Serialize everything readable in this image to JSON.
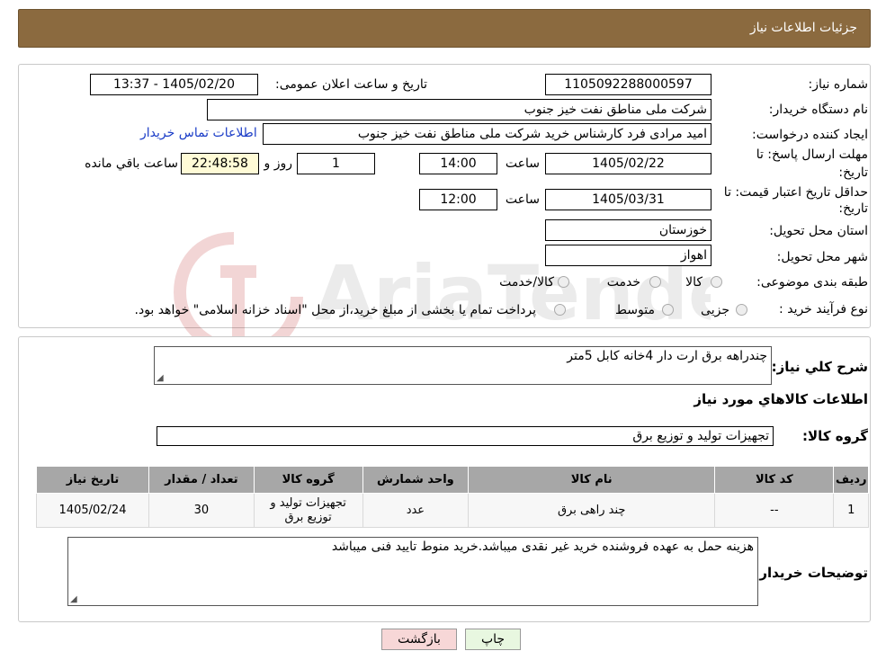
{
  "header": {
    "title": "جزئیات اطلاعات نیاز"
  },
  "labels": {
    "need_number": "شماره نیاز:",
    "announce_date": "تاریخ و ساعت اعلان عمومی:",
    "buyer_org": "نام دستگاه خریدار:",
    "requester": "ایجاد کننده درخواست:",
    "reply_deadline_1": "مهلت ارسال پاسخ: تا",
    "reply_deadline_2": "تاریخ:",
    "time": "ساعت",
    "day_and": "روز و",
    "remaining": "ساعت باقي مانده",
    "price_valid_1": "حداقل تاریخ اعتبار قیمت: تا",
    "price_valid_2": "تاریخ:",
    "province": "استان محل تحویل:",
    "city": "شهر محل تحویل:",
    "category": "طبقه بندی موضوعی:",
    "process": "نوع فرآیند خرید :",
    "summary": "شرح كلي نياز:",
    "goods_info": "اطلاعات كالاهاي مورد نياز",
    "goods_group": "گروه كالا:",
    "buyer_notes": "توضیحات خریدار:"
  },
  "values": {
    "need_number": "1105092288000597",
    "announce_date": "1405/02/20 - 13:37",
    "buyer_org": "شرکت ملی مناطق نفت خیز جنوب",
    "requester": "امید مرادی فرد کارشناس خرید شرکت ملی مناطق نفت خیز جنوب",
    "contact_link": "اطلاعات تماس خریدار",
    "reply_date": "1405/02/22",
    "reply_time": "14:00",
    "days": "1",
    "remaining_time": "22:48:58",
    "price_date": "1405/03/31",
    "price_time": "12:00",
    "province": "خوزستان",
    "city": "اهواز",
    "summary": "چندراهه برق ارت دار 4خانه کابل 5متر",
    "goods_group": "تجهیزات تولید و توزیع برق",
    "buyer_notes": "هزینه حمل به عهده فروشنده خرید غیر نقدی میباشد.خرید منوط تایید فنی میباشد"
  },
  "category_options": [
    "کالا",
    "خدمت",
    "کالا/خدمت"
  ],
  "process_options": [
    "جزیی",
    "متوسط"
  ],
  "process_note": "پرداخت تمام یا بخشی از مبلغ خرید،از محل \"اسناد خزانه اسلامی\" خواهد بود.",
  "table": {
    "headers": [
      "ردیف",
      "کد کالا",
      "نام کالا",
      "واحد شمارش",
      "گروه کالا",
      "تعداد / مقدار",
      "تاریخ نیاز"
    ],
    "rows": [
      [
        "1",
        "--",
        "چند راهی برق",
        "عدد",
        "تجهیزات تولید و توزیع برق",
        "30",
        "1405/02/24"
      ]
    ]
  },
  "buttons": {
    "print": "چاپ",
    "back": "بازگشت"
  },
  "watermark": "AriaTender.neT",
  "colors": {
    "header_bg": "#8b6a3f",
    "link": "#1a3cc7",
    "back_button_bg": "#f7d7d7",
    "print_button_bg": "#e8f7e0"
  }
}
